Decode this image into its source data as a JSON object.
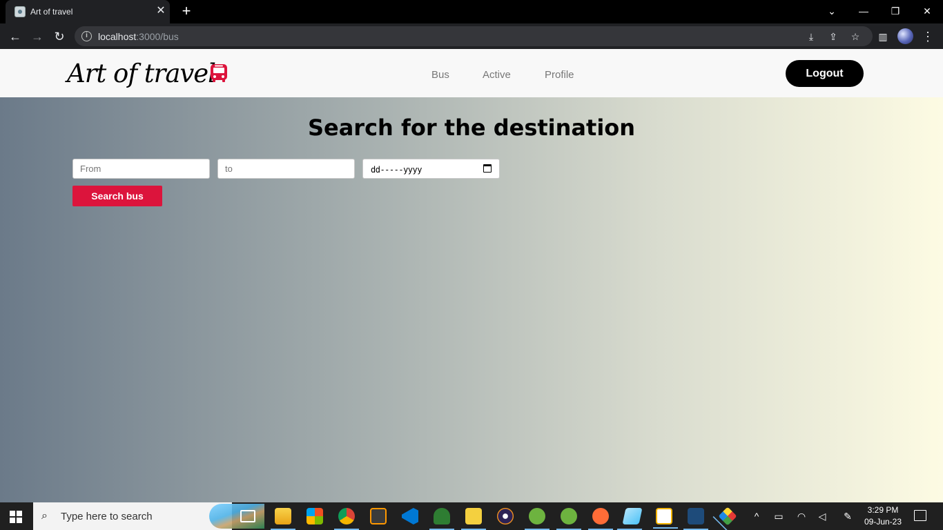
{
  "browser": {
    "tab_title": "Art of travel",
    "url_host": "localhost",
    "url_path": ":3000/bus"
  },
  "navbar": {
    "logo_text": "Art of travel",
    "links": [
      "Bus",
      "Active",
      "Profile"
    ],
    "logout_label": "Logout"
  },
  "main": {
    "heading": "Search for the destination",
    "from_placeholder": "From",
    "to_placeholder": "to",
    "date_placeholder": "dd-----yyyy",
    "search_button": "Search bus"
  },
  "taskbar": {
    "search_placeholder": "Type here to search",
    "time": "3:29 PM",
    "date": "09-Jun-23"
  },
  "colors": {
    "accent_red": "#dc143c",
    "gradient_start": "#6b7a89",
    "gradient_end": "#fdfbe3"
  }
}
